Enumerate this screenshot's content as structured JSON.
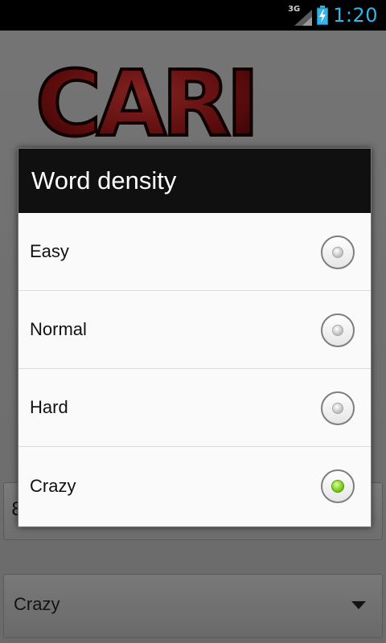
{
  "status_bar": {
    "network": "3G",
    "time": "1:20",
    "icons": [
      "signal-icon",
      "battery-charging-icon"
    ],
    "accent_color": "#33b5e5"
  },
  "background": {
    "logo_text": "CARI",
    "field_peek": "8",
    "spinner_value": "Crazy"
  },
  "dialog": {
    "title": "Word density",
    "options": [
      {
        "label": "Easy",
        "checked": false
      },
      {
        "label": "Normal",
        "checked": false
      },
      {
        "label": "Hard",
        "checked": false
      },
      {
        "label": "Crazy",
        "checked": true
      }
    ],
    "checked_color": "#6cc012"
  }
}
